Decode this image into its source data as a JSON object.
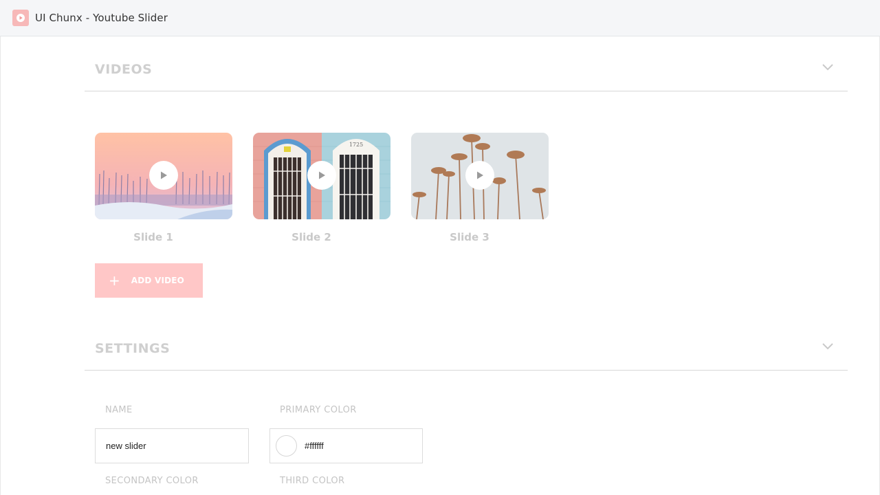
{
  "window": {
    "title": "UI Chunx - Youtube Slider",
    "logo_color": "#f7b8b8"
  },
  "videos": {
    "title": "VIDEOS",
    "toggle_icon": "chevron-down-icon",
    "slides": [
      {
        "label": "Slide 1",
        "scene": "winter trees under pink sky"
      },
      {
        "label": "Slide 2",
        "scene": "two arched doors, number 1725"
      },
      {
        "label": "Slide 3",
        "scene": "palm trees against pale sky"
      }
    ],
    "door_number": "1725",
    "add_button": {
      "icon": "plus-icon",
      "label": "ADD VIDEO",
      "color": "#ffc7c7"
    }
  },
  "settings": {
    "title": "SETTINGS",
    "toggle_icon": "chevron-down-icon",
    "name_label": "NAME",
    "name_value": "new slider",
    "primary_color_label": "PRIMARY COLOR",
    "primary_color_value": "#ffffff",
    "primary_color_display": "#ffffff",
    "secondary_color_label": "SECONDARY COLOR",
    "third_color_label": "THIRD COLOR"
  }
}
